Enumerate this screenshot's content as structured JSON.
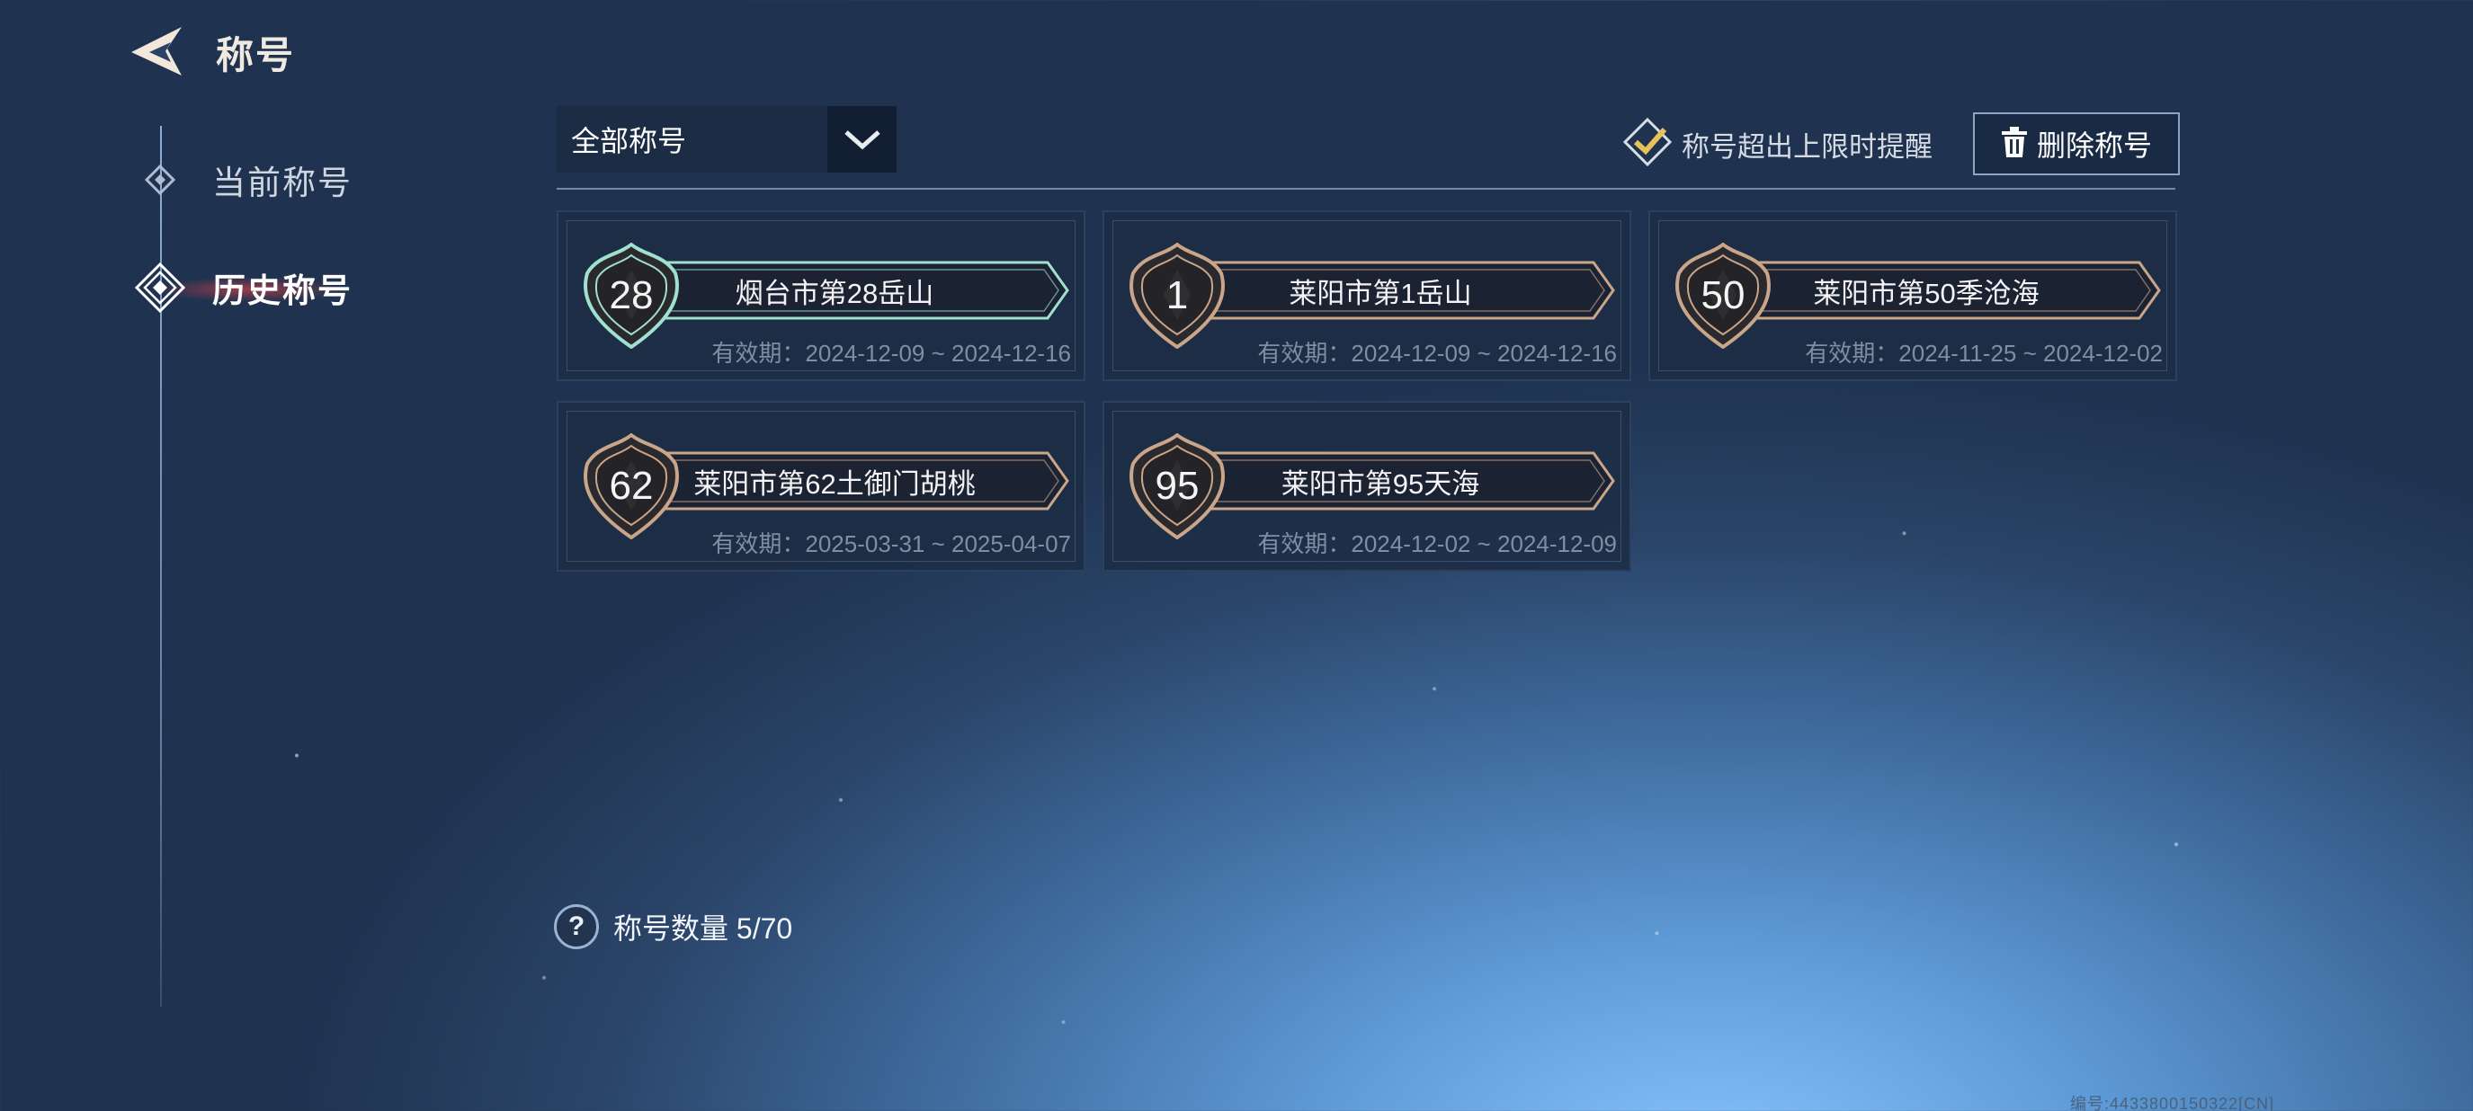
{
  "header": {
    "title": "称号",
    "back_icon": "back-arrow-icon"
  },
  "sidebar": {
    "items": [
      {
        "label": "当前称号",
        "active": false
      },
      {
        "label": "历史称号",
        "active": true
      }
    ]
  },
  "toolbar": {
    "filter_value": "全部称号",
    "remind_label": "称号超出上限时提醒",
    "remind_checked": true,
    "delete_label": "删除称号"
  },
  "cards": [
    {
      "rank": "28",
      "name": "烟台市第28岳山",
      "validity": "有效期：2024-12-09 ~ 2024-12-16",
      "badge_style": "jade"
    },
    {
      "rank": "1",
      "name": "莱阳市第1岳山",
      "validity": "有效期：2024-12-09 ~ 2024-12-16",
      "badge_style": "bronze"
    },
    {
      "rank": "50",
      "name": "莱阳市第50季沧海",
      "validity": "有效期：2024-11-25 ~ 2024-12-02",
      "badge_style": "bronze"
    },
    {
      "rank": "62",
      "name": "莱阳市第62土御门胡桃",
      "validity": "有效期：2025-03-31 ~ 2025-04-07",
      "badge_style": "bronze"
    },
    {
      "rank": "95",
      "name": "莱阳市第95天海",
      "validity": "有效期：2024-12-02 ~ 2024-12-09",
      "badge_style": "bronze"
    }
  ],
  "footer": {
    "help_symbol": "?",
    "count_text": "称号数量 5/70",
    "uid_text": "编号:4433800150322[CN]"
  },
  "colors": {
    "jade": "#9fe0cf",
    "bronze": "#c9a58a",
    "accent_gold": "#e7c25a",
    "active_glow": "#ff4646"
  }
}
